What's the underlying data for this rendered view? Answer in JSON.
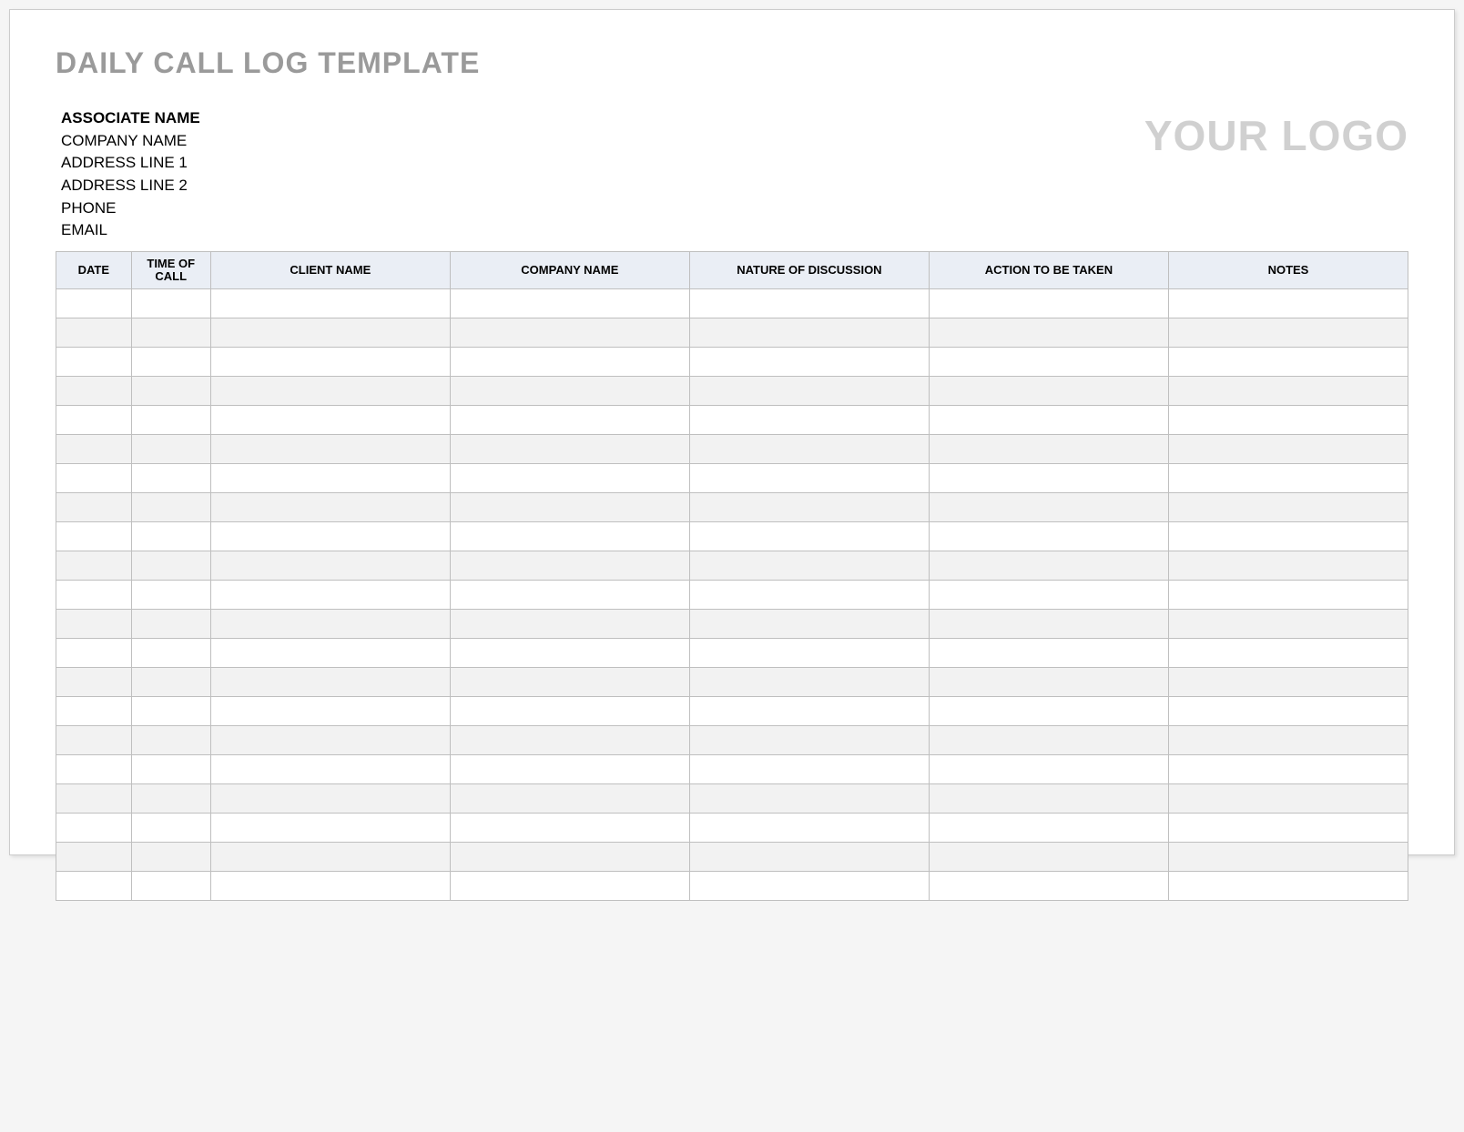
{
  "title": "DAILY CALL LOG TEMPLATE",
  "associate": {
    "name_label": "ASSOCIATE NAME",
    "company_label": "COMPANY NAME",
    "address1_label": "ADDRESS LINE 1",
    "address2_label": "ADDRESS LINE 2",
    "phone_label": "PHONE",
    "email_label": "EMAIL"
  },
  "logo_placeholder": "YOUR LOGO",
  "columns": {
    "date": "DATE",
    "time": "TIME OF CALL",
    "client": "CLIENT NAME",
    "company": "COMPANY NAME",
    "nature": "NATURE OF DISCUSSION",
    "action": "ACTION TO BE TAKEN",
    "notes": "NOTES"
  },
  "rows": [
    {
      "date": "",
      "time": "",
      "client": "",
      "company": "",
      "nature": "",
      "action": "",
      "notes": ""
    },
    {
      "date": "",
      "time": "",
      "client": "",
      "company": "",
      "nature": "",
      "action": "",
      "notes": ""
    },
    {
      "date": "",
      "time": "",
      "client": "",
      "company": "",
      "nature": "",
      "action": "",
      "notes": ""
    },
    {
      "date": "",
      "time": "",
      "client": "",
      "company": "",
      "nature": "",
      "action": "",
      "notes": ""
    },
    {
      "date": "",
      "time": "",
      "client": "",
      "company": "",
      "nature": "",
      "action": "",
      "notes": ""
    },
    {
      "date": "",
      "time": "",
      "client": "",
      "company": "",
      "nature": "",
      "action": "",
      "notes": ""
    },
    {
      "date": "",
      "time": "",
      "client": "",
      "company": "",
      "nature": "",
      "action": "",
      "notes": ""
    },
    {
      "date": "",
      "time": "",
      "client": "",
      "company": "",
      "nature": "",
      "action": "",
      "notes": ""
    },
    {
      "date": "",
      "time": "",
      "client": "",
      "company": "",
      "nature": "",
      "action": "",
      "notes": ""
    },
    {
      "date": "",
      "time": "",
      "client": "",
      "company": "",
      "nature": "",
      "action": "",
      "notes": ""
    },
    {
      "date": "",
      "time": "",
      "client": "",
      "company": "",
      "nature": "",
      "action": "",
      "notes": ""
    },
    {
      "date": "",
      "time": "",
      "client": "",
      "company": "",
      "nature": "",
      "action": "",
      "notes": ""
    },
    {
      "date": "",
      "time": "",
      "client": "",
      "company": "",
      "nature": "",
      "action": "",
      "notes": ""
    },
    {
      "date": "",
      "time": "",
      "client": "",
      "company": "",
      "nature": "",
      "action": "",
      "notes": ""
    },
    {
      "date": "",
      "time": "",
      "client": "",
      "company": "",
      "nature": "",
      "action": "",
      "notes": ""
    },
    {
      "date": "",
      "time": "",
      "client": "",
      "company": "",
      "nature": "",
      "action": "",
      "notes": ""
    },
    {
      "date": "",
      "time": "",
      "client": "",
      "company": "",
      "nature": "",
      "action": "",
      "notes": ""
    },
    {
      "date": "",
      "time": "",
      "client": "",
      "company": "",
      "nature": "",
      "action": "",
      "notes": ""
    },
    {
      "date": "",
      "time": "",
      "client": "",
      "company": "",
      "nature": "",
      "action": "",
      "notes": ""
    },
    {
      "date": "",
      "time": "",
      "client": "",
      "company": "",
      "nature": "",
      "action": "",
      "notes": ""
    },
    {
      "date": "",
      "time": "",
      "client": "",
      "company": "",
      "nature": "",
      "action": "",
      "notes": ""
    }
  ]
}
